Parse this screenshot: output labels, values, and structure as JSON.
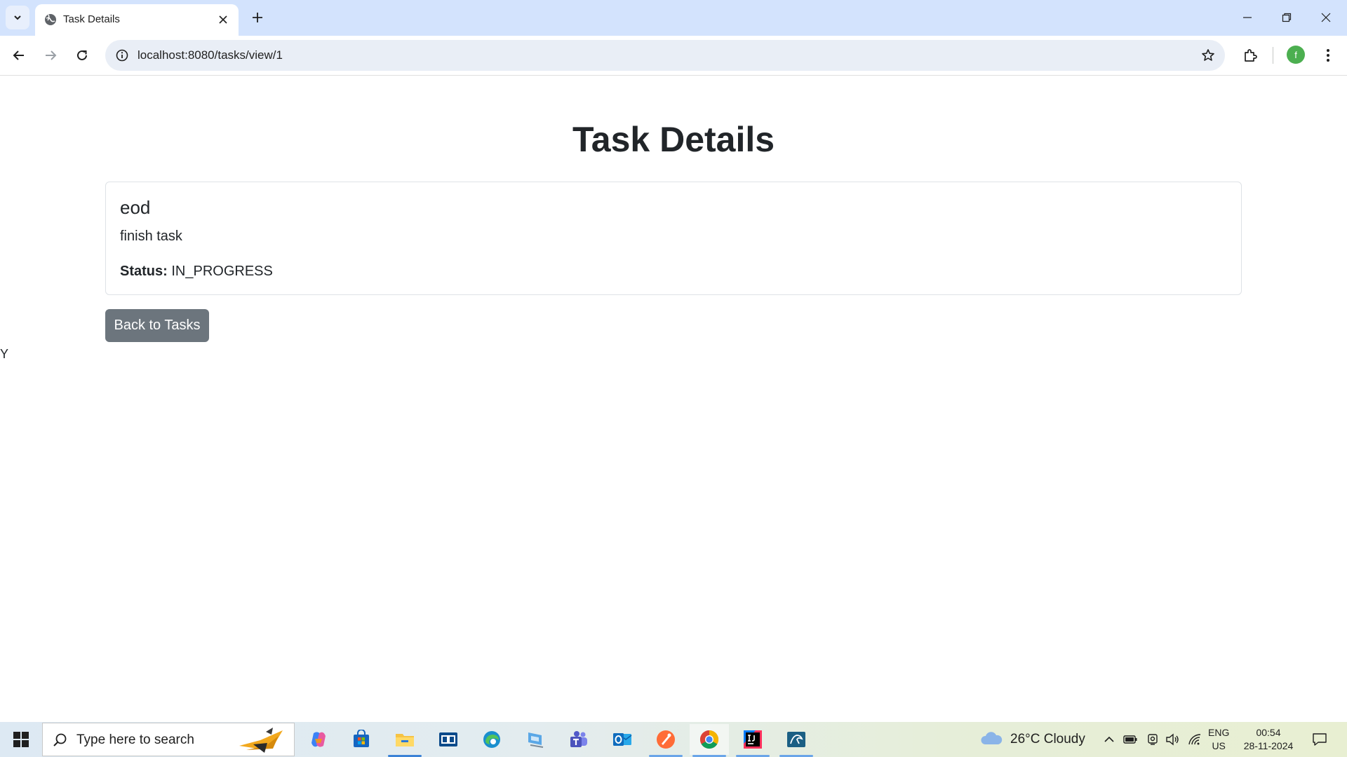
{
  "browser": {
    "tab_title": "Task Details",
    "url": "localhost:8080/tasks/view/1",
    "profile_initial": "f"
  },
  "page": {
    "heading": "Task Details",
    "task": {
      "title": "eod",
      "description": "finish task",
      "status_label": "Status:",
      "status_value": "IN_PROGRESS"
    },
    "back_button_label": "Back to Tasks",
    "stray_text": "Y"
  },
  "taskbar": {
    "search_placeholder": "Type here to search",
    "apps": [
      "copilot-icon",
      "microsoft-store-icon",
      "file-explorer-icon",
      "dell-icon",
      "edge-icon",
      "remote-desktop-icon",
      "teams-icon",
      "outlook-icon",
      "postman-icon",
      "chrome-icon",
      "intellij-icon",
      "mysql-workbench-icon"
    ],
    "weather": "26°C  Cloudy",
    "language_line1": "ENG",
    "language_line2": "US",
    "time": "00:54",
    "date": "28-11-2024"
  },
  "colors": {
    "tab_strip": "#d3e3fd",
    "secondary_button": "#6c757d",
    "text": "#212529",
    "card_border": "#dee2e6"
  }
}
